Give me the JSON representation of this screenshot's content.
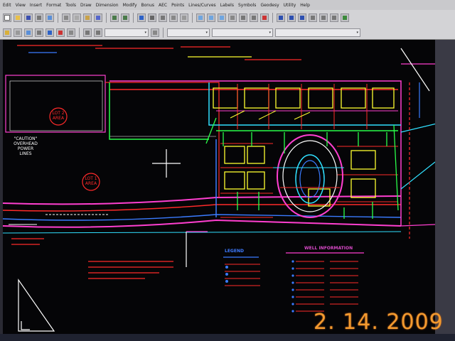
{
  "menu": [
    "Edit",
    "View",
    "Insert",
    "Format",
    "Tools",
    "Draw",
    "Dimension",
    "Modify",
    "Bonus",
    "AEC",
    "Points",
    "Lines/Curves",
    "Labels",
    "Symbols",
    "Geodesy",
    "Utility",
    "Help"
  ],
  "plan": {
    "labels": {
      "overhead_power": "\"CAUTION\"\nOVERHEAD\nPOWER\nLINES",
      "lot_left": "LOT 2\nAREA",
      "lot_right": "LOT 1\nAREA"
    },
    "legend_title": "LEGEND",
    "well_info_title": "WELL INFORMATION"
  },
  "colors": {
    "accent_red": "#ff2a2a",
    "accent_yellow": "#ffff30",
    "accent_cyan": "#30e0ff",
    "accent_magenta": "#ff3fd0",
    "accent_green": "#2aff4a",
    "accent_blue": "#3a7bff",
    "timestamp_orange": "#f39a2f"
  },
  "timestamp": "2. 14. 2009"
}
